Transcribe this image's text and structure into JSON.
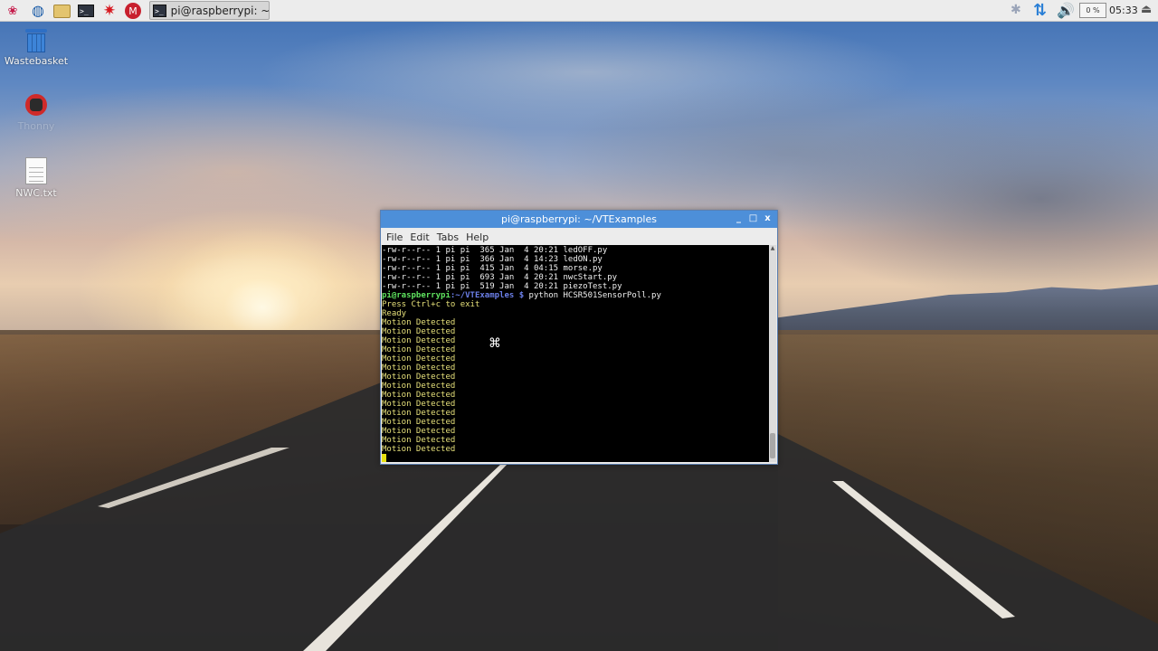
{
  "taskbar": {
    "launchers": [
      {
        "name": "raspberry-menu",
        "glyph": "❀"
      },
      {
        "name": "web-browser",
        "glyph": "◍"
      },
      {
        "name": "file-manager",
        "glyph": ""
      },
      {
        "name": "terminal",
        "glyph": ">_"
      },
      {
        "name": "mathematica",
        "glyph": "✷"
      },
      {
        "name": "wolfram",
        "glyph": "M"
      }
    ],
    "task_button": {
      "label": "pi@raspberrypi: ~/VT...",
      "icon_glyph": ">_"
    },
    "tray": {
      "bluetooth_glyph": "✱",
      "network_glyph": "⇅",
      "volume_glyph": "🔊",
      "cpu_usage": "0 %",
      "clock": "05:33",
      "eject_glyph": "⏏"
    }
  },
  "desktop": {
    "icons": [
      {
        "label": "Wastebasket"
      },
      {
        "label": "Thonny"
      },
      {
        "label": "NWC.txt"
      }
    ]
  },
  "terminal": {
    "title": "pi@raspberrypi: ~/VTExamples",
    "controls": {
      "minimize": "_",
      "maximize": "□",
      "close": "x"
    },
    "menu": [
      "File",
      "Edit",
      "Tabs",
      "Help"
    ],
    "file_lines": [
      "-rw-r--r-- 1 pi pi  365 Jan  4 20:21 ledOFF.py",
      "-rw-r--r-- 1 pi pi  366 Jan  4 14:23 ledON.py",
      "-rw-r--r-- 1 pi pi  415 Jan  4 04:15 morse.py",
      "-rw-r--r-- 1 pi pi  693 Jan  4 20:21 nwcStart.py",
      "-rw-r--r-- 1 pi pi  519 Jan  4 20:21 piezoTest.py"
    ],
    "prompt": {
      "user_host": "pi@raspberrypi",
      "path": ":~/VTExamples $",
      "command": " python HCSR501SensorPoll.py"
    },
    "output_lines": [
      "Press Ctrl+c to exit",
      "Ready",
      "Motion Detected",
      "Motion Detected",
      "Motion Detected",
      "Motion Detected",
      "Motion Detected",
      "Motion Detected",
      "Motion Detected",
      "Motion Detected",
      "Motion Detected",
      "Motion Detected",
      "Motion Detected",
      "Motion Detected",
      "Motion Detected",
      "Motion Detected",
      "Motion Detected"
    ]
  }
}
